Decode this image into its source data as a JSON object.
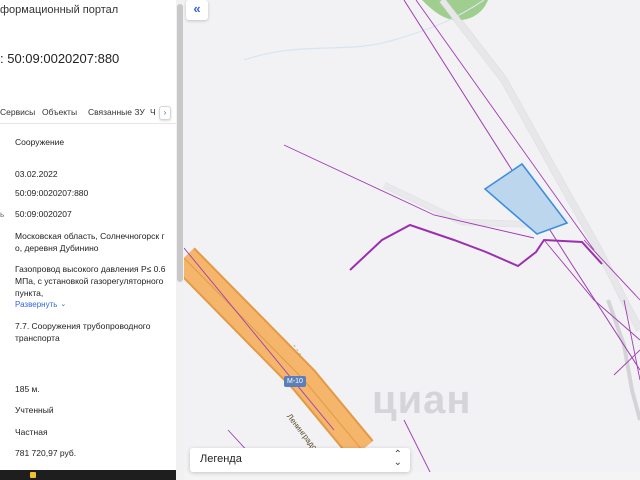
{
  "panel": {
    "portal_title": "формационный портал",
    "cad_number": ": 50:09:0020207:880",
    "tabs": [
      "Сервисы",
      "Объекты",
      "Связанные ЗУ",
      "Ч"
    ],
    "tab_more": "›",
    "fields": [
      {
        "mark": "",
        "value": "Сооружение"
      },
      {
        "mark": "",
        "value": "03.02.2022"
      },
      {
        "mark": "",
        "value": "50:09:0020207:880"
      },
      {
        "mark": "ь",
        "value": "50:09:0020207"
      },
      {
        "mark": "",
        "value": "Московская область, Солнечногорск г о, деревня Дубинино"
      },
      {
        "mark": "",
        "value": "Газопровод высокого давления Р≤ 0.6 МПа, с установкой газорегуляторного пункта,"
      },
      {
        "mark": "",
        "value": "7.7. Сооружения трубопроводного транспорта"
      },
      {
        "mark": "",
        "value": "185 м."
      },
      {
        "mark": "",
        "value": "Учтенный"
      },
      {
        "mark": "",
        "value": "Частная"
      },
      {
        "mark": "",
        "value": "781 720,97 руб."
      }
    ],
    "expand_link": "Развернуть",
    "expand_icon": "chevron-down-icon"
  },
  "map": {
    "collapse_icon": "double-chevron-left-icon",
    "collapse_label": "«",
    "road_badge": "M-10",
    "road_label": "Ленинградск",
    "watermark": "циан",
    "legend_label": "Легенда",
    "legend_icon": "up-down-chevron-icon",
    "colors": {
      "background": "#f2f2f4",
      "highway_fill": "#f5b56b",
      "highway_edge": "#e39a48",
      "pipeline": "#a03cb4",
      "parcel_fill": "#bcd6ee",
      "parcel_stroke": "#3f8de0",
      "forest": "#9fce8f",
      "accent": "#3566e0"
    }
  }
}
